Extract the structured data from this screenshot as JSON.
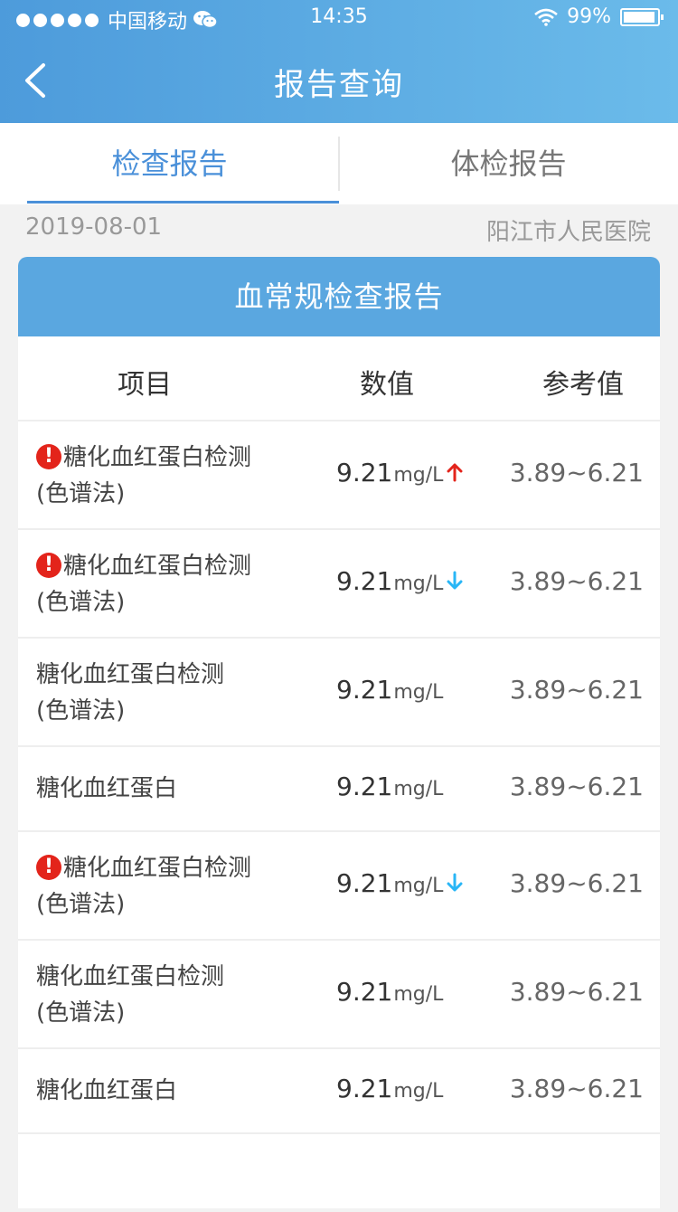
{
  "status_bar": {
    "carrier": "中国移动",
    "time": "14:35",
    "battery": "99%",
    "icons": [
      "signal-dots-icon",
      "wechat-icon",
      "wifi-icon",
      "battery-icon"
    ]
  },
  "nav": {
    "title": "报告查询",
    "back_icon": "chevron-left-icon"
  },
  "tabs": [
    {
      "label": "检查报告",
      "active": true
    },
    {
      "label": "体检报告",
      "active": false
    }
  ],
  "report": {
    "date": "2019-08-01",
    "hospital": "阳江市人民医院",
    "title": "血常规检查报告",
    "columns": {
      "item": "项目",
      "value": "数值",
      "reference": "参考值"
    },
    "rows": [
      {
        "name": "糖化血红蛋白检测",
        "sub": "(色谱法)",
        "value": "9.21",
        "unit": "mg/L",
        "reference": "3.89~6.21",
        "warning": true,
        "trend": "up"
      },
      {
        "name": "糖化血红蛋白检测",
        "sub": "(色谱法)",
        "value": "9.21",
        "unit": "mg/L",
        "reference": "3.89~6.21",
        "warning": true,
        "trend": "down"
      },
      {
        "name": "糖化血红蛋白检测",
        "sub": "(色谱法)",
        "value": "9.21",
        "unit": "mg/L",
        "reference": "3.89~6.21",
        "warning": false,
        "trend": "none"
      },
      {
        "name": "糖化血红蛋白",
        "sub": "",
        "value": "9.21",
        "unit": "mg/L",
        "reference": "3.89~6.21",
        "warning": false,
        "trend": "none"
      },
      {
        "name": "糖化血红蛋白检测",
        "sub": "(色谱法)",
        "value": "9.21",
        "unit": "mg/L",
        "reference": "3.89~6.21",
        "warning": true,
        "trend": "down"
      },
      {
        "name": "糖化血红蛋白检测",
        "sub": "(色谱法)",
        "value": "9.21",
        "unit": "mg/L",
        "reference": "3.89~6.21",
        "warning": false,
        "trend": "none"
      },
      {
        "name": "糖化血红蛋白",
        "sub": "",
        "value": "9.21",
        "unit": "mg/L",
        "reference": "3.89~6.21",
        "warning": false,
        "trend": "none"
      }
    ]
  },
  "colors": {
    "accent": "#4a90d9",
    "header_start": "#4d9bdb",
    "header_end": "#6bbbea",
    "card_title": "#5aa7e0",
    "warning": "#e3241b",
    "trend_up": "#e3241b",
    "trend_down": "#29b6f6"
  }
}
